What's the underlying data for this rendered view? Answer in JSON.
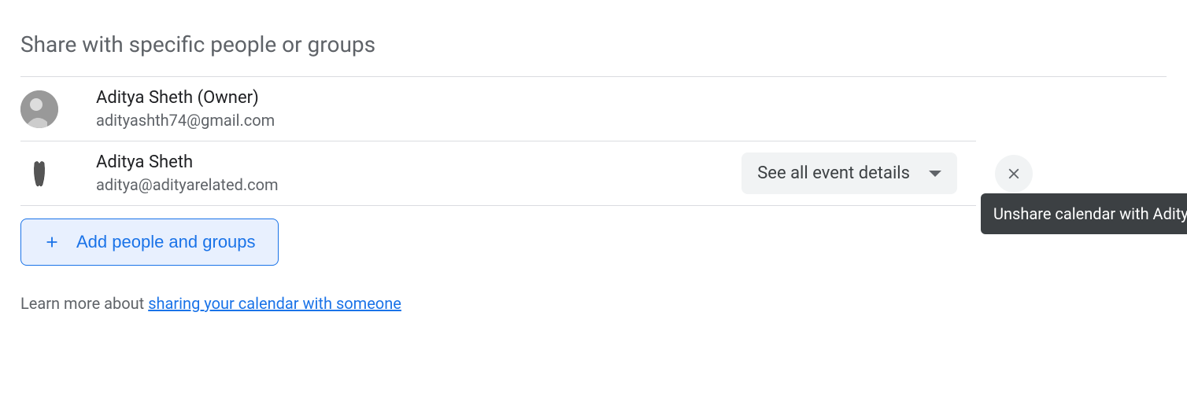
{
  "section": {
    "title": "Share with specific people or groups"
  },
  "people": [
    {
      "name": "Aditya Sheth (Owner)",
      "email": "adityashth74@gmail.com"
    },
    {
      "name": "Aditya Sheth",
      "email": "aditya@adityarelated.com",
      "permission": "See all event details"
    }
  ],
  "addButton": {
    "label": "Add people and groups"
  },
  "learnMore": {
    "prefix": "Learn more about ",
    "linkText": "sharing your calendar with someone"
  },
  "tooltip": {
    "text": "Unshare calendar with Aditya Sheth"
  }
}
